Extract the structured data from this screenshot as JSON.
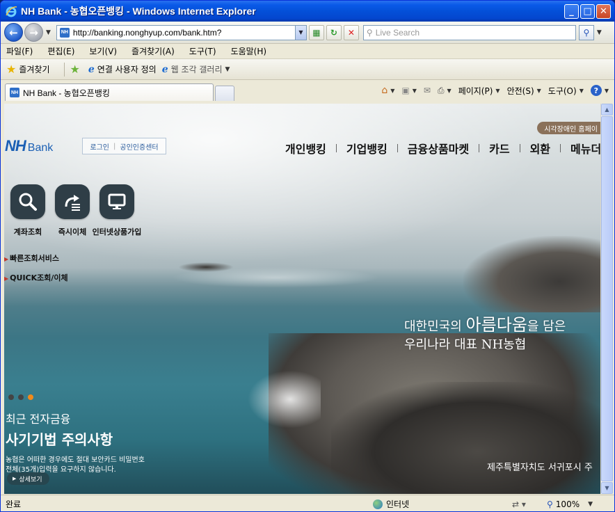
{
  "window": {
    "title": "NH Bank - 농협오픈뱅킹 - Windows Internet Explorer"
  },
  "address": {
    "url": "http://banking.nonghyup.com/bank.htm?",
    "search_placeholder": "Live Search",
    "favicon_text": "NH"
  },
  "menu": [
    "파일(F)",
    "편집(E)",
    "보기(V)",
    "즐겨찾기(A)",
    "도구(T)",
    "도움말(H)"
  ],
  "favorites": {
    "label": "즐겨찾기",
    "link1": "연결 사용자 정의",
    "link2": "웹 조각 갤러리"
  },
  "tab": {
    "title": "NH Bank - 농협오픈뱅킹"
  },
  "commandbar": {
    "page": "페이지(P)",
    "safety": "안전(S)",
    "tools": "도구(O)"
  },
  "site": {
    "logo_nh": "NH",
    "logo_bank": "Bank",
    "login": "로그인",
    "cert_center": "공인인증센터",
    "accessibility": "시각장애인 홈페이",
    "gnb": [
      "개인뱅킹",
      "기업뱅킹",
      "금융상품마켓",
      "카드",
      "외환",
      "메뉴더"
    ],
    "quick": [
      {
        "label": "계좌조회",
        "icon": "search-icon"
      },
      {
        "label": "즉시이체",
        "icon": "transfer-icon"
      },
      {
        "label": "인터넷상품가입",
        "icon": "monitor-icon"
      }
    ],
    "links": [
      "빠른조회서비스",
      "QUICK조회/이체"
    ],
    "notice": {
      "line1": "최근 전자금융",
      "line2": "사기기법 주의사항",
      "desc1": "농협은 어떠한 경우에도 절대 보안카드 비밀번호",
      "desc2": "전체(35개)입력을 요구하지 않습니다.",
      "more": "상세보기"
    },
    "slogan": {
      "part1": "대한민국의 ",
      "big": "아름다움",
      "part2": "을 담은",
      "line2": "우리나라 대표 NH농협"
    },
    "photo_caption": "제주특별자치도 서귀포시 주"
  },
  "status": {
    "text": "완료",
    "zone": "인터넷",
    "zoom": "100%"
  }
}
